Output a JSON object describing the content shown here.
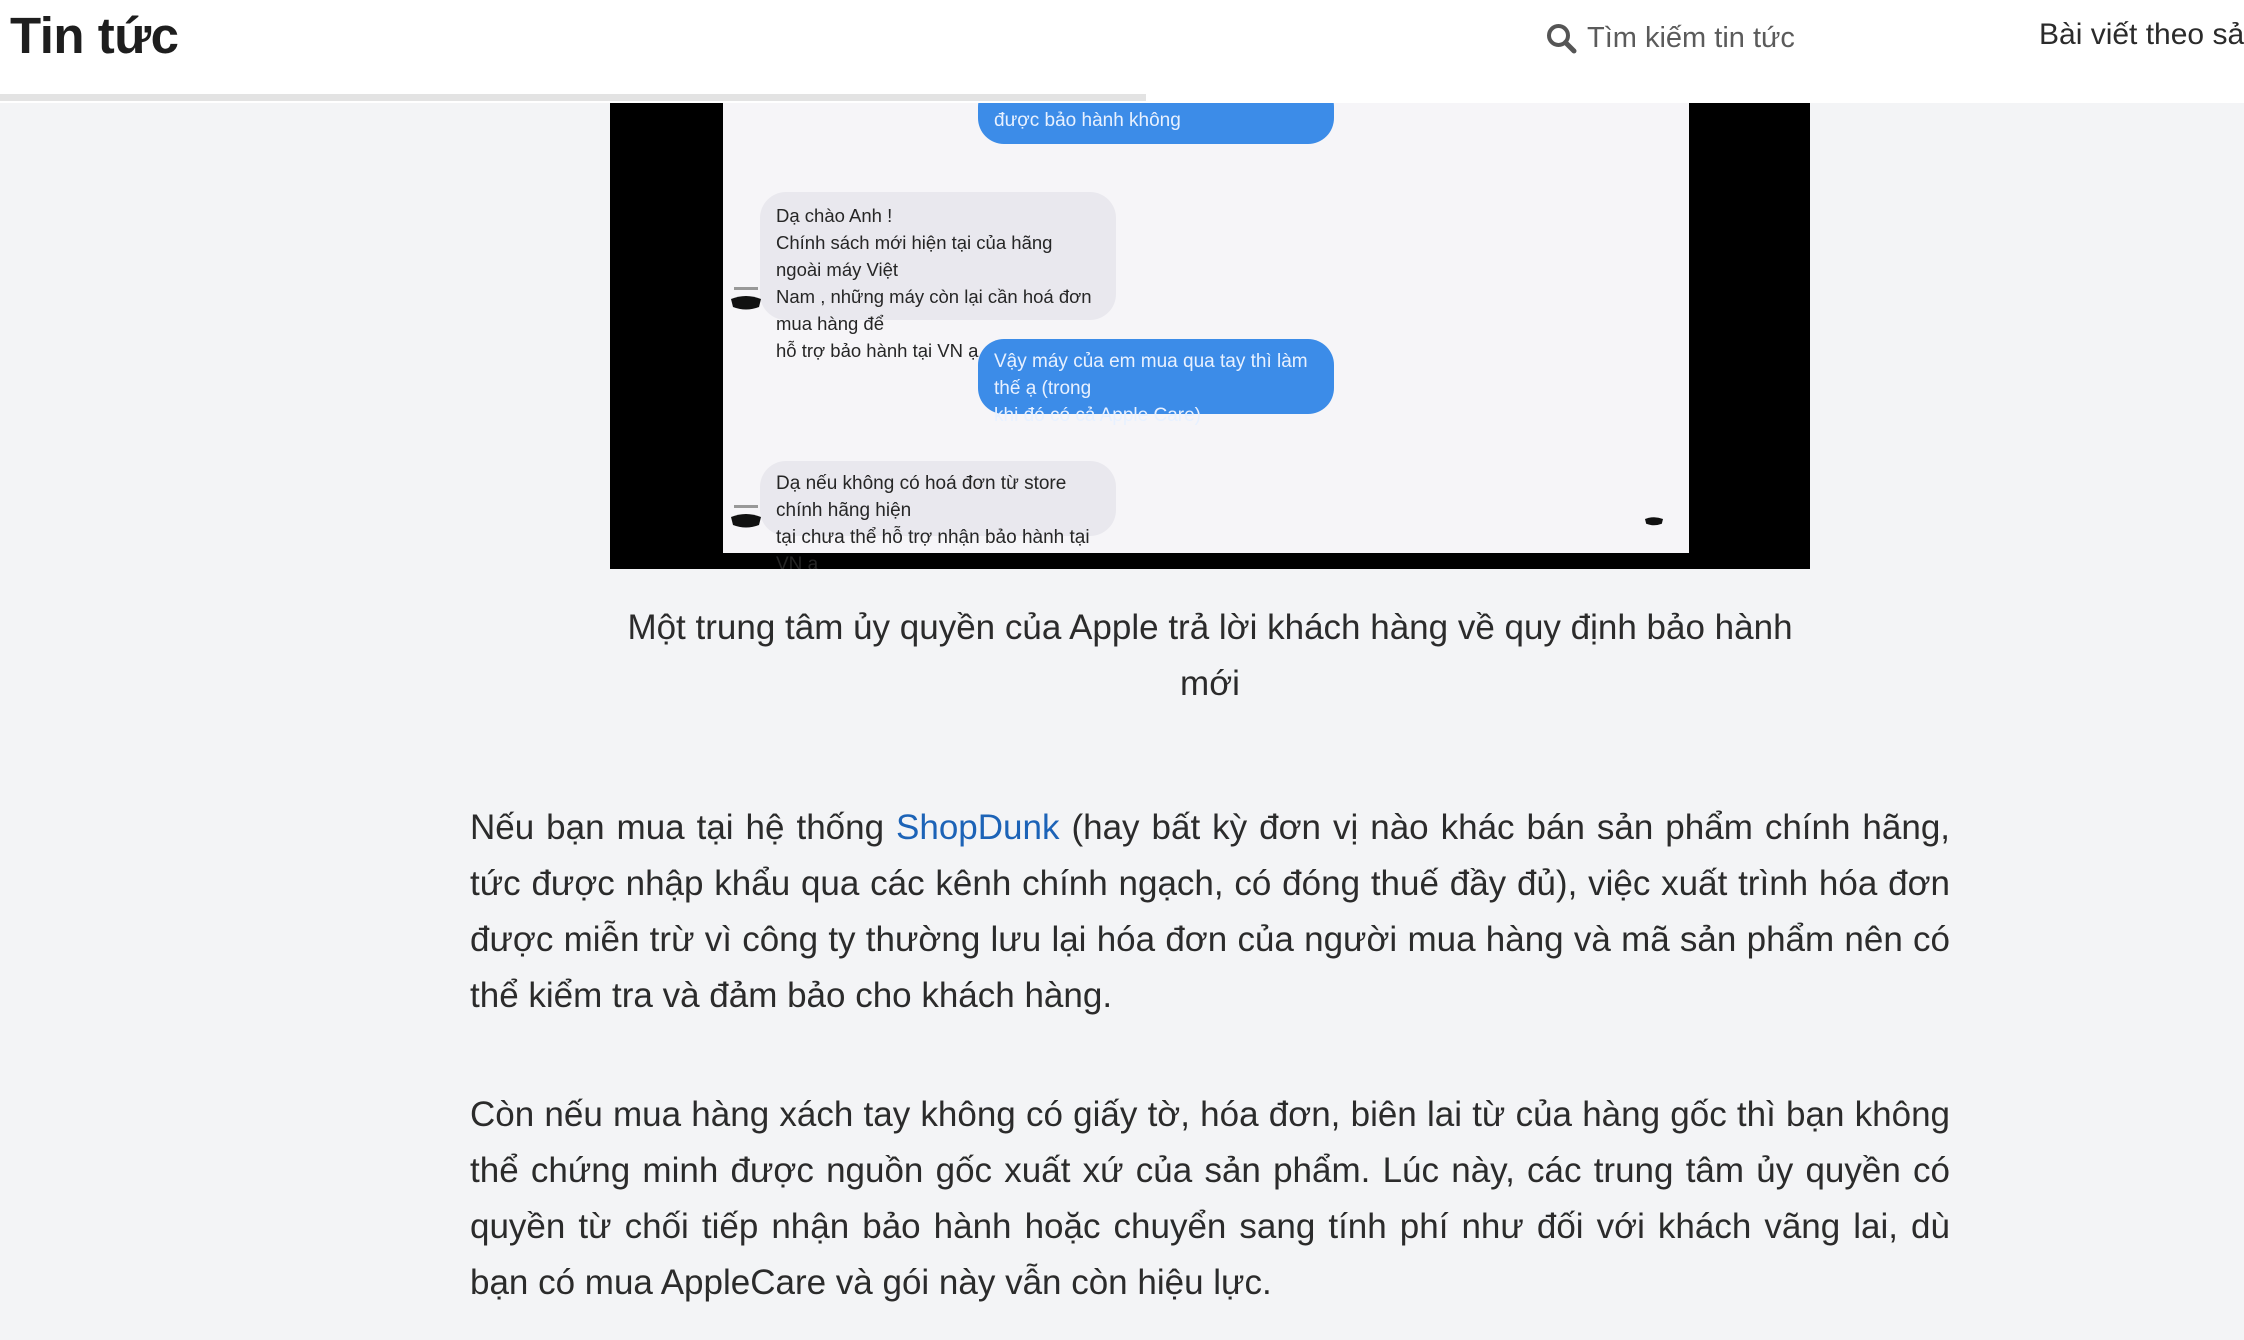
{
  "header": {
    "title": "Tin tức",
    "search_placeholder": "Tìm kiếm tin tức",
    "topic_link": "Bài viết theo sả",
    "reading_progress": 0.51
  },
  "figure": {
    "bubbles": [
      {
        "from": "customer",
        "text": "được bảo hành không"
      },
      {
        "from": "store",
        "text": "Dạ chào Anh !\nChính sách mới hiện tại của hãng ngoài máy Việt\nNam , những máy còn lại cần hoá đơn mua hàng để\nhỗ trợ bảo hành tại VN ạ"
      },
      {
        "from": "customer",
        "text": "Vậy máy của em mua qua tay thì làm thế  ạ (trong\nkhi đó có cả Apple Care)"
      },
      {
        "from": "store",
        "text": "Dạ nếu không có hoá đơn từ store chính hãng hiện\ntại chưa thể hỗ trợ nhận bảo hành tại VN ạ"
      }
    ],
    "caption": "Một trung tâm ủy quyền của Apple trả lời khách hàng về quy định bảo hành mới"
  },
  "article": {
    "p1_before": "Nếu bạn mua tại hệ thống ",
    "p1_link": "ShopDunk",
    "p1_after": " (hay bất kỳ đơn vị nào khác bán sản phẩm chính hãng, tức được nhập khẩu qua các kênh chính ngạch, có đóng thuế đầy đủ), việc xuất trình hóa đơn được miễn trừ vì công ty thường lưu lại hóa đơn của người mua hàng và mã sản phẩm nên có thể kiểm tra và đảm bảo cho khách hàng.",
    "p2": "Còn nếu mua hàng xách tay không có giấy tờ, hóa đơn, biên lai từ của hàng gốc thì bạn không thể chứng minh được nguồn gốc xuất xứ của sản phẩm. Lúc này, các trung tâm ủy quyền có quyền từ chối tiếp nhận bảo hành hoặc chuyển sang tính phí như đối với khách vãng lai, dù bạn có mua AppleCare và gói này vẫn còn hiệu lực."
  },
  "colors": {
    "link": "#1c63b7",
    "outgoing_bubble": "#3c8ce8",
    "page_background": "#f3f4f6"
  },
  "icons": [
    "search-icon",
    "store-avatar-icon"
  ]
}
